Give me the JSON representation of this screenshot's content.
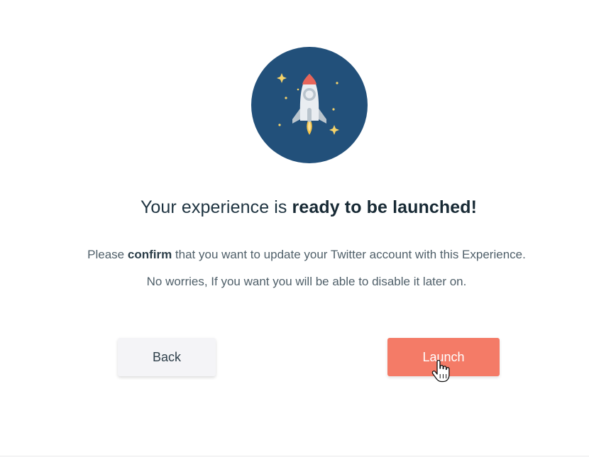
{
  "illustration": {
    "icon": "rocket-icon",
    "background_color": "#22507a"
  },
  "headline": {
    "regular": "Your experience is ",
    "emphasis": "ready to be launched!"
  },
  "message": {
    "line1_prefix": "Please ",
    "line1_emphasis": "confirm",
    "line1_suffix": " that you want to update your Twitter account with this Experience.",
    "line2": "No worries, If you want you will be able to disable it later on."
  },
  "actions": {
    "back_label": "Back",
    "launch_label": "Launch"
  },
  "colors": {
    "accent": "#f47b67",
    "heading": "#1f3441",
    "body_text": "#4f5f69",
    "secondary_button": "#f4f4f7"
  },
  "cursor": {
    "icon": "hand-pointer-icon"
  }
}
